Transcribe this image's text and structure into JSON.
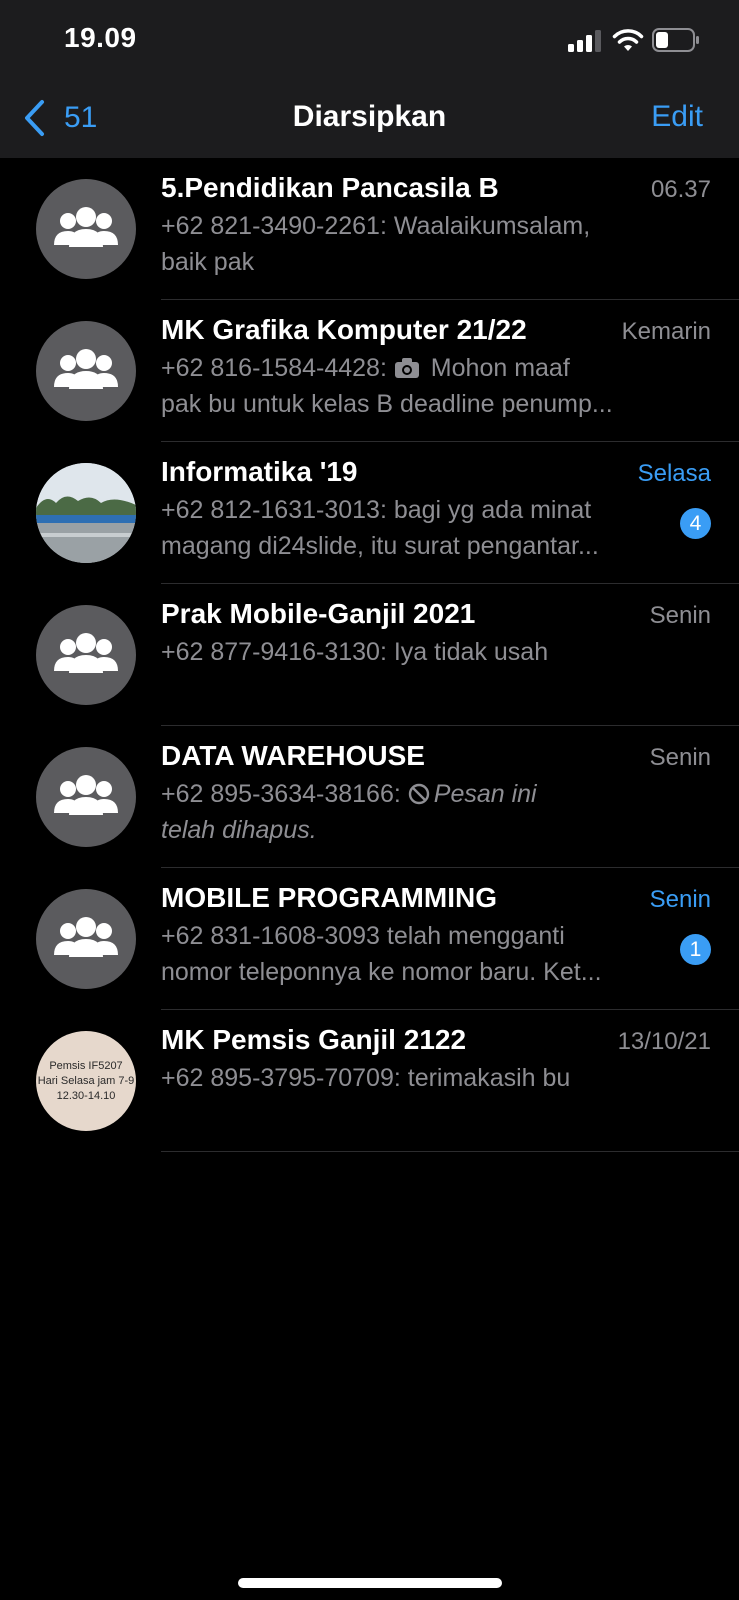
{
  "status_bar": {
    "time": "19.09"
  },
  "nav": {
    "back_count": "51",
    "title": "Diarsipkan",
    "edit_label": "Edit"
  },
  "chats": [
    {
      "name": "5.Pendidikan Pancasila B",
      "time": "06.37",
      "sender": "+62 821-3490-2261",
      "line1": ": Waalaikumsalam,",
      "line2": "baik pak",
      "unread": ""
    },
    {
      "name": "MK Grafika Komputer 21/22",
      "time": "Kemarin",
      "sender": "+62 816-1584-4428",
      "line1": " Mohon maaf",
      "line2": "pak bu untuk kelas B deadline penump...",
      "unread": ""
    },
    {
      "name": "Informatika '19",
      "time": "Selasa",
      "sender": "+62 812-1631-3013",
      "line1": ": bagi yg ada minat",
      "line2": "magang di24slide, itu surat pengantar...",
      "unread": "4"
    },
    {
      "name": "Prak Mobile-Ganjil 2021",
      "time": "Senin",
      "sender": "+62 877-9416-3130",
      "line1": ": Iya tidak usah",
      "line2": "",
      "unread": ""
    },
    {
      "name": "DATA WAREHOUSE",
      "time": "Senin",
      "sender": "+62 895-3634-38166",
      "line1": "Pesan ini",
      "line2": "telah dihapus.",
      "unread": ""
    },
    {
      "name": "MOBILE PROGRAMMING",
      "time": "Senin",
      "sender": "",
      "line1": "+62 831-1608-3093 telah mengganti",
      "line2": "nomor teleponnya ke nomor baru. Ket...",
      "unread": "1"
    },
    {
      "name": "MK Pemsis Ganjil 2122",
      "time": "13/10/21",
      "sender": "+62 895-3795-70709",
      "line1": ": terimakasih bu",
      "line2": "",
      "unread": "",
      "avatar_text": [
        "Pemsis IF5207",
        "Hari Selasa jam 7-9",
        "12.30-14.10"
      ]
    }
  ],
  "colors": {
    "accent": "#3a9df5",
    "secondary_text": "#8e8e93",
    "bar_bg": "#1c1c1e",
    "avatar_bg": "#5b5b5e"
  },
  "icons": {
    "group_avatar": "group-icon",
    "back": "chevron-left-icon",
    "photo": "camera-icon",
    "deleted": "prohibited-icon"
  }
}
